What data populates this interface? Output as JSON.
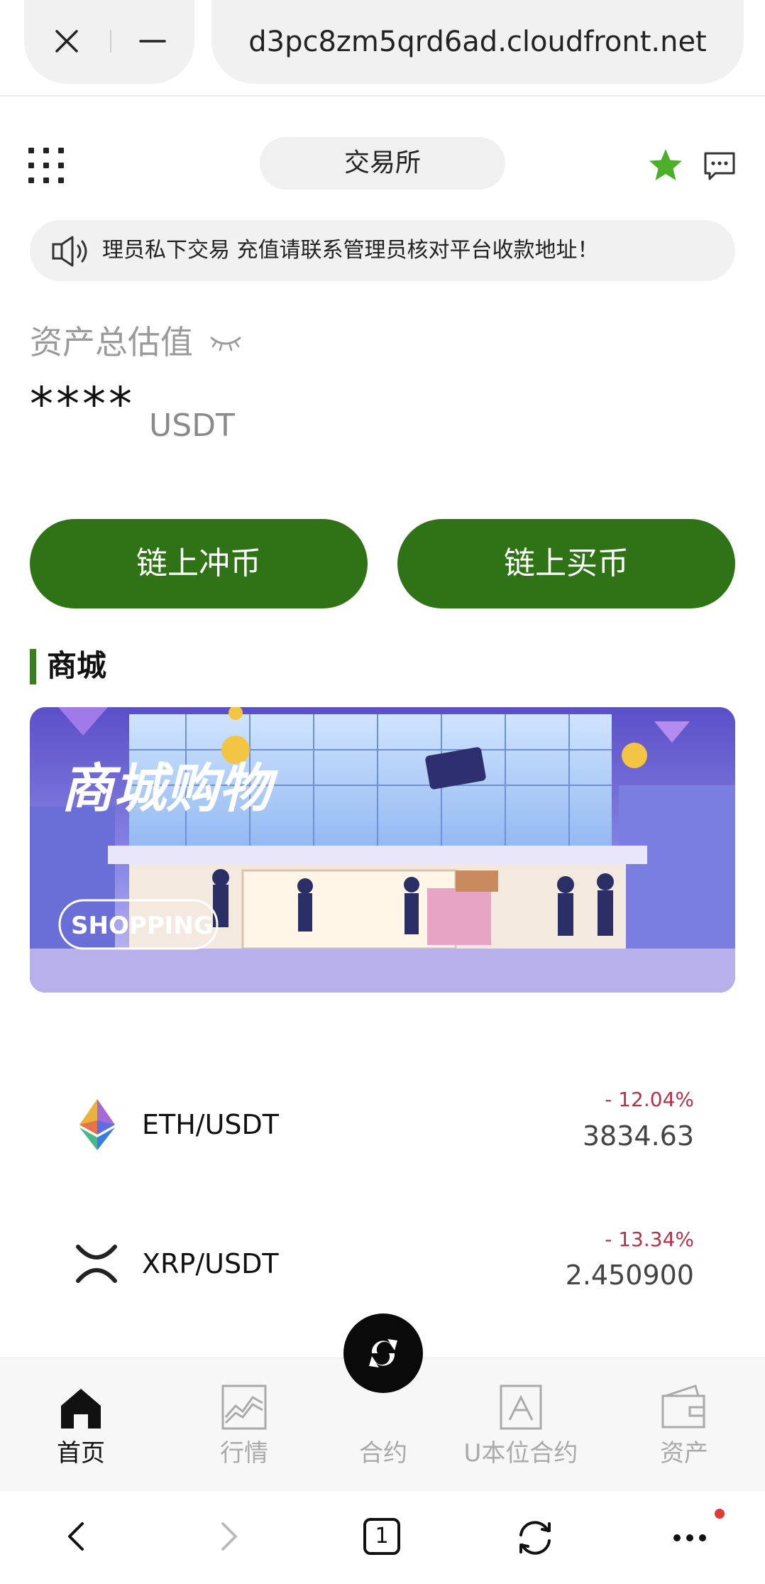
{
  "browser": {
    "url": "d3pc8zm5qrd6ad.cloudfront.net",
    "tab_count": "1"
  },
  "header": {
    "title": "交易所"
  },
  "notice": {
    "text": "理员私下交易 充值请联系管理员核对平台收款地址！"
  },
  "assets": {
    "label": "资产总估值",
    "value_masked": "****",
    "unit": "USDT"
  },
  "actions": {
    "deposit_label": "链上冲币",
    "buy_label": "链上买币"
  },
  "mall": {
    "section_title": "商城",
    "banner_title": "商城购物",
    "banner_tag": "SHOPPING"
  },
  "coins": [
    {
      "pair": "ETH/USDT",
      "change": "- 12.04%",
      "price": "3834.63",
      "icon": "ethereum-icon"
    },
    {
      "pair": "XRP/USDT",
      "change": "- 13.34%",
      "price": "2.450900",
      "icon": "xrp-icon"
    }
  ],
  "nav": {
    "items": [
      {
        "label": "首页",
        "icon": "home-icon",
        "active": true
      },
      {
        "label": "行情",
        "icon": "market-chart-icon",
        "active": false
      },
      {
        "label": "合约",
        "icon": "swap-icon",
        "active": false
      },
      {
        "label": "U本位合约",
        "icon": "contract-icon",
        "active": false
      },
      {
        "label": "资产",
        "icon": "wallet-icon",
        "active": false
      }
    ]
  },
  "colors": {
    "accent_green": "#2f7316",
    "negative_red": "#b3324a",
    "star_green": "#4caf2a"
  }
}
